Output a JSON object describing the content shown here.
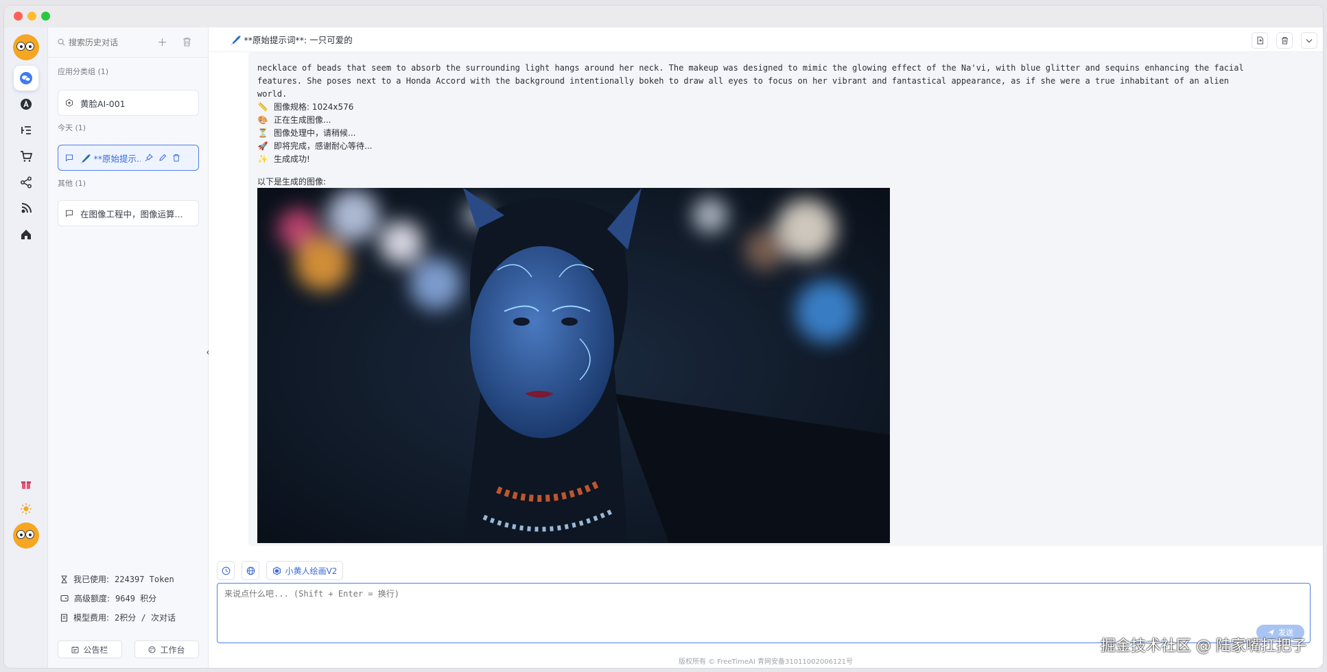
{
  "window": {
    "controls": [
      "close",
      "minimize",
      "maximize"
    ]
  },
  "rail": {
    "items": [
      {
        "name": "chat",
        "icon": "chat-bubbles-icon",
        "active": true
      },
      {
        "name": "app-store",
        "icon": "app-store-icon"
      },
      {
        "name": "list",
        "icon": "list-icon"
      },
      {
        "name": "cart",
        "icon": "cart-icon"
      },
      {
        "name": "share",
        "icon": "share-icon"
      },
      {
        "name": "feed",
        "icon": "signal-icon"
      },
      {
        "name": "home",
        "icon": "home-icon"
      }
    ],
    "bottom": {
      "gift": "gift-icon",
      "theme": "sun-icon"
    }
  },
  "sidebar": {
    "search_placeholder": "搜索历史对话",
    "groups": [
      {
        "label": "应用分类组 (1)",
        "items": [
          {
            "title": "黄脸AI-001"
          }
        ]
      },
      {
        "label": "今天 (1)",
        "items": [
          {
            "title": "🖊️ **原始提示...",
            "active": true
          }
        ]
      },
      {
        "label": "其他 (1)",
        "items": [
          {
            "title": "在图像工程中，图像运算..."
          }
        ]
      }
    ],
    "stats": [
      {
        "label": "我已使用:",
        "value": "224397 Token",
        "icon": "hourglass-icon"
      },
      {
        "label": "高级额度:",
        "value": "9649 积分",
        "icon": "wallet-icon"
      },
      {
        "label": "模型费用:",
        "value": "2积分 / 次对话",
        "icon": "receipt-icon"
      }
    ],
    "footer": {
      "notice_label": "公告栏",
      "workspace_label": "工作台"
    }
  },
  "main": {
    "title": "🖊️ **原始提示词**:  一只可爱的",
    "message": {
      "text": "necklace of beads that seem to absorb the surrounding light hangs around her neck. The makeup was designed to mimic the glowing effect of the Na'vi, with blue glitter and sequins enhancing the facial\nfeatures. She poses next to a Honda Accord with the background intentionally bokeh to draw all eyes to focus on her vibrant and fantastical appearance, as if she were a true inhabitant of an alien\nworld.",
      "status": [
        {
          "emoji": "📏",
          "text": "图像规格: 1024x576"
        },
        {
          "emoji": "🎨",
          "text": "正在生成图像..."
        },
        {
          "emoji": "⏳",
          "text": "图像处理中，请稍候..."
        },
        {
          "emoji": "🚀",
          "text": "即将完成，感谢耐心等待..."
        },
        {
          "emoji": "✨",
          "text": "生成成功!"
        }
      ],
      "image_caption": "以下是生成的图像:"
    },
    "toolbar": {
      "model_label": "小黄人绘画V2"
    },
    "composer": {
      "placeholder": "来说点什么吧... (Shift + Enter = 换行)",
      "send_label": "发送"
    },
    "copyright": "版权所有 © FreeTimeAI  青网安备31011002006121号",
    "watermark": "掘金技术社区 @ 陆家嘴扛把子"
  },
  "colors": {
    "accent": "#4e7fe8",
    "avatar": "#f6a623"
  }
}
